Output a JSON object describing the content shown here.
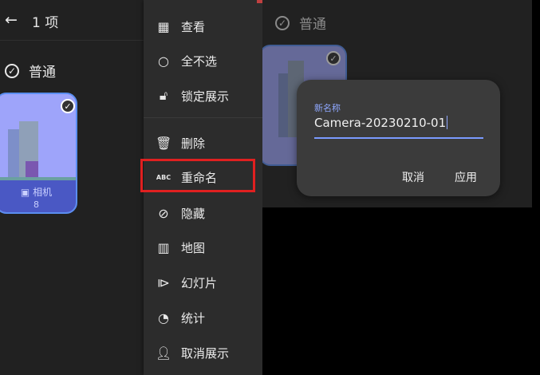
{
  "left": {
    "back_icon": "arrow-left-icon",
    "selected_count": "1 项",
    "section_title": "普通",
    "album": {
      "name": "相机",
      "count": "8"
    }
  },
  "menu": {
    "items": [
      {
        "icon": "grid-icon",
        "label": "查看"
      },
      {
        "icon": "circle-icon",
        "label": "全不选"
      },
      {
        "icon": "lock-icon",
        "label": "锁定展示"
      },
      {
        "icon": "trash-icon",
        "label": "删除"
      },
      {
        "icon": "abc-icon",
        "label": "重命名"
      },
      {
        "icon": "eye-off-icon",
        "label": "隐藏"
      },
      {
        "icon": "map-icon",
        "label": "地图"
      },
      {
        "icon": "slideshow-icon",
        "label": "幻灯片"
      },
      {
        "icon": "stats-icon",
        "label": "统计"
      },
      {
        "icon": "person-icon",
        "label": "取消展示"
      }
    ],
    "highlight_color": "#e02020"
  },
  "right": {
    "section_title": "普通",
    "dialog": {
      "field_label": "新名称",
      "field_value": "Camera-20230210-01",
      "cancel": "取消",
      "apply": "应用"
    },
    "accent": "#7a9aff"
  }
}
